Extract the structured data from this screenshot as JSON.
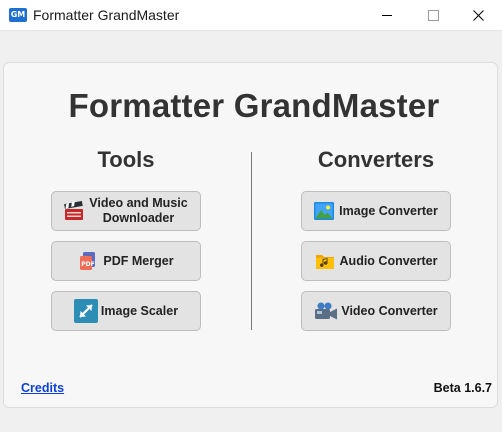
{
  "window": {
    "icon_text": "GM",
    "title": "Formatter GrandMaster"
  },
  "header": {
    "title": "Formatter GrandMaster"
  },
  "tools": {
    "title": "Tools",
    "buttons": [
      {
        "label": "Video and Music Downloader",
        "icon": "clapperboard-icon"
      },
      {
        "label": "PDF Merger",
        "icon": "pdf-icon"
      },
      {
        "label": "Image Scaler",
        "icon": "resize-arrow-icon"
      }
    ]
  },
  "converters": {
    "title": "Converters",
    "buttons": [
      {
        "label": "Image Converter",
        "icon": "image-landscape-icon"
      },
      {
        "label": "Audio Converter",
        "icon": "music-folder-icon"
      },
      {
        "label": "Video Converter",
        "icon": "video-camera-icon"
      }
    ]
  },
  "footer": {
    "credits": "Credits",
    "version": "Beta 1.6.7"
  },
  "colors": {
    "link": "#0b3fd6",
    "title_text": "#333333",
    "button_bg": "#e3e3e3"
  }
}
